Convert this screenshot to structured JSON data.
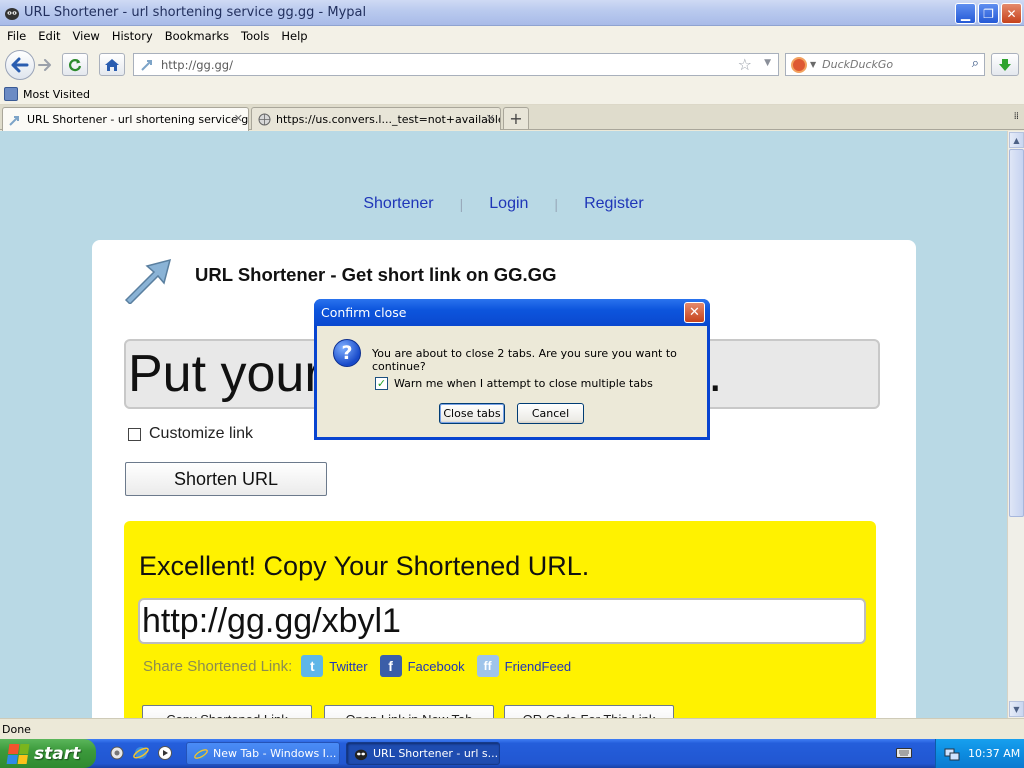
{
  "window": {
    "title": "URL Shortener - url shortening service gg.gg - Mypal",
    "min_glyph": "▁",
    "max_glyph": "❐",
    "close_glyph": "✕"
  },
  "menu": [
    "File",
    "Edit",
    "View",
    "History",
    "Bookmarks",
    "Tools",
    "Help"
  ],
  "navbar": {
    "url": "http://gg.gg/",
    "search_placeholder": "DuckDuckGo"
  },
  "bookmarks": {
    "most_visited": "Most Visited"
  },
  "tabs": [
    {
      "label": "URL Shortener - url shortening service gg...",
      "close": "✕"
    },
    {
      "label": "https://us.convers.l..._test=not+available",
      "close": "✕"
    }
  ],
  "newtab_glyph": "+",
  "page": {
    "nav": [
      "Shortener",
      "Login",
      "Register"
    ],
    "nav_sep": "|",
    "heading": "URL Shortener - Get short link on GG.GG",
    "input_text_left": "Put your",
    "input_text_right": ".",
    "customize_label": "Customize link",
    "shorten_button": "Shorten URL",
    "result": {
      "title": "Excellent! Copy Your Shortened URL.",
      "short_url": "http://gg.gg/xbyl1",
      "share_label": "Share Shortened Link:",
      "share": [
        "Twitter",
        "Facebook",
        "FriendFeed"
      ],
      "buttons": [
        "Copy Shortened Link",
        "Open Link in New Tab",
        "QR Code For This Link"
      ]
    }
  },
  "dialog": {
    "title": "Confirm close",
    "message": "You are about to close 2 tabs. Are you sure you want to continue?",
    "warn_label": "Warn me when I attempt to close multiple tabs",
    "warn_checked": true,
    "close_tabs_button": "Close tabs",
    "cancel_button": "Cancel"
  },
  "status": "Done",
  "taskbar": {
    "start": "start",
    "tasks": [
      "New Tab - Windows I...",
      "URL Shortener - url s..."
    ],
    "clock": "10:37 AM"
  }
}
